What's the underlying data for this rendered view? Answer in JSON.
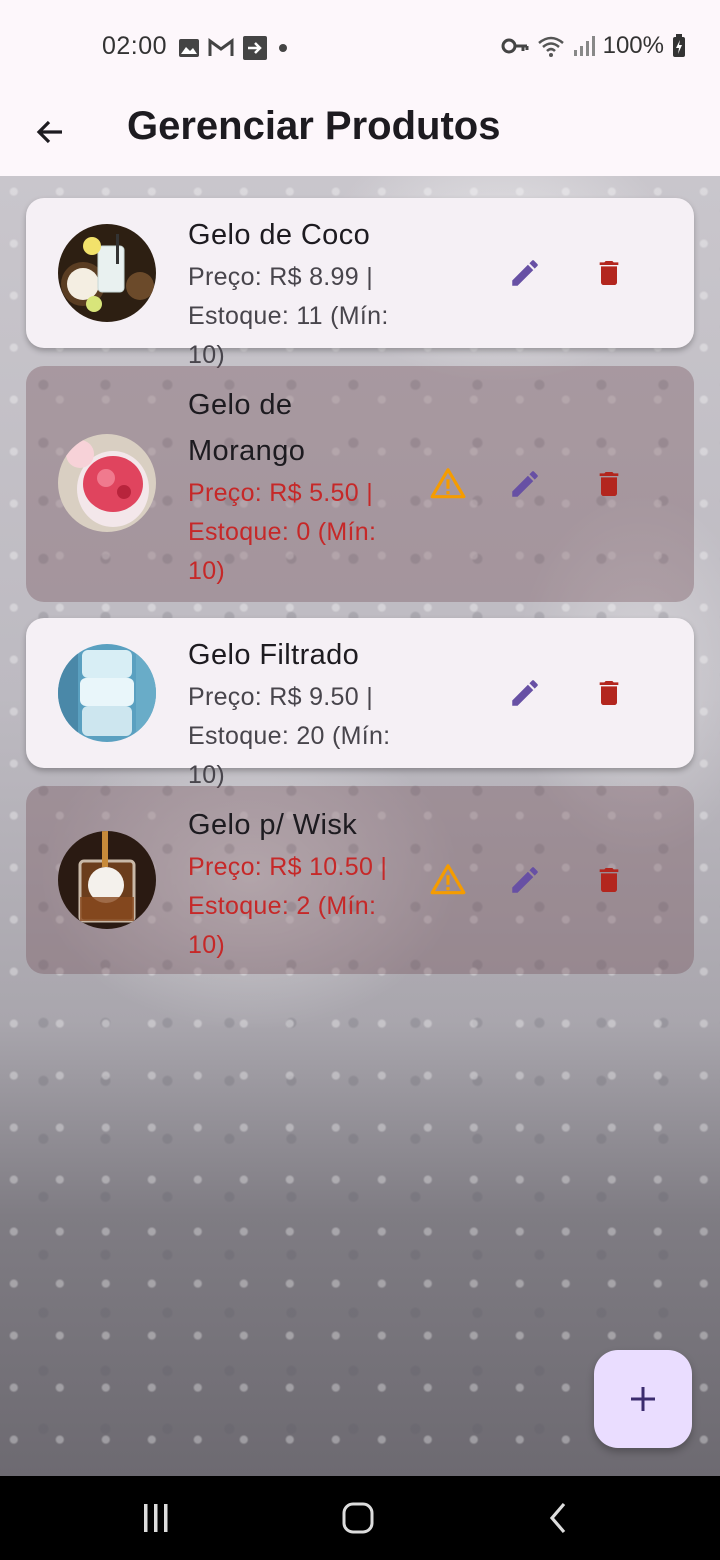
{
  "status_bar": {
    "time": "02:00",
    "battery": "100%"
  },
  "app_bar": {
    "title": "Gerenciar Produtos"
  },
  "products": [
    {
      "name": "Gelo de Coco",
      "price_line": "Preço: R$ 8.99 |",
      "stock_line": "Estoque: 11 (Mín: 10)",
      "low_stock": false,
      "icon": "coconut-drink"
    },
    {
      "name_line1": "Gelo de",
      "name_line2": "Morango",
      "price_line": "Preço: R$ 5.50 |",
      "stock_line1": "Estoque: 0 (Mín:",
      "stock_line2": "10)",
      "low_stock": true,
      "icon": "strawberry-drink"
    },
    {
      "name": "Gelo Filtrado",
      "price_line": "Preço: R$ 9.50 |",
      "stock_line": "Estoque: 20 (Mín: 10)",
      "low_stock": false,
      "icon": "ice-cubes"
    },
    {
      "name": "Gelo p/ Wisk",
      "price_line": "Preço: R$ 10.50 |",
      "stock_line1": "Estoque: 2 (Mín:",
      "stock_line2": "10)",
      "low_stock": true,
      "icon": "whisky-glass"
    }
  ],
  "colors": {
    "edit": "#6750a4",
    "delete": "#b3261e",
    "warning": "#f59c00",
    "low_text": "#c62828",
    "fab": "#eaddff"
  }
}
